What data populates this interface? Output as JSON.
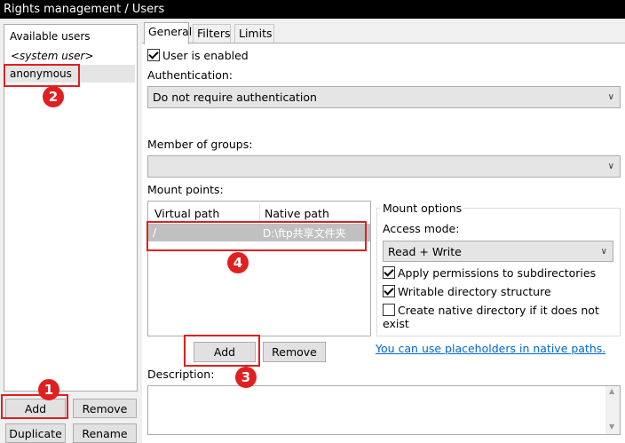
{
  "window": {
    "title": "Rights management / Users"
  },
  "users": {
    "header": "Available users",
    "items": [
      "<system user>",
      "anonymous"
    ],
    "buttons": {
      "add": "Add",
      "remove": "Remove",
      "duplicate": "Duplicate",
      "rename": "Rename"
    }
  },
  "tabs": [
    "General",
    "Filters",
    "Limits"
  ],
  "general": {
    "user_enabled_label": "User is enabled",
    "authentication_label": "Authentication:",
    "authentication_value": "Do not require authentication",
    "member_of_groups_label": "Member of groups:",
    "member_of_groups_value": "",
    "mount_points_label": "Mount points:",
    "mount_table": {
      "columns": [
        "Virtual path",
        "Native path"
      ],
      "rows": [
        {
          "virtual": "/",
          "native": "D:\\ftp共享文件夹"
        }
      ]
    },
    "mount_buttons": {
      "add": "Add",
      "remove": "Remove"
    },
    "mount_options": {
      "title": "Mount options",
      "access_mode_label": "Access mode:",
      "access_mode_value": "Read + Write",
      "apply_permissions": "Apply permissions to subdirectories",
      "writable_structure": "Writable directory structure",
      "create_native": "Create native directory if it does not exist"
    },
    "placeholders_link": "You can use placeholders in native paths.",
    "description_label": "Description:",
    "description_value": ""
  },
  "annotations": [
    "1",
    "2",
    "3",
    "4"
  ],
  "colors": {
    "highlight": "#e02020",
    "link": "#0066cc",
    "selection": "#c0c0c0"
  }
}
